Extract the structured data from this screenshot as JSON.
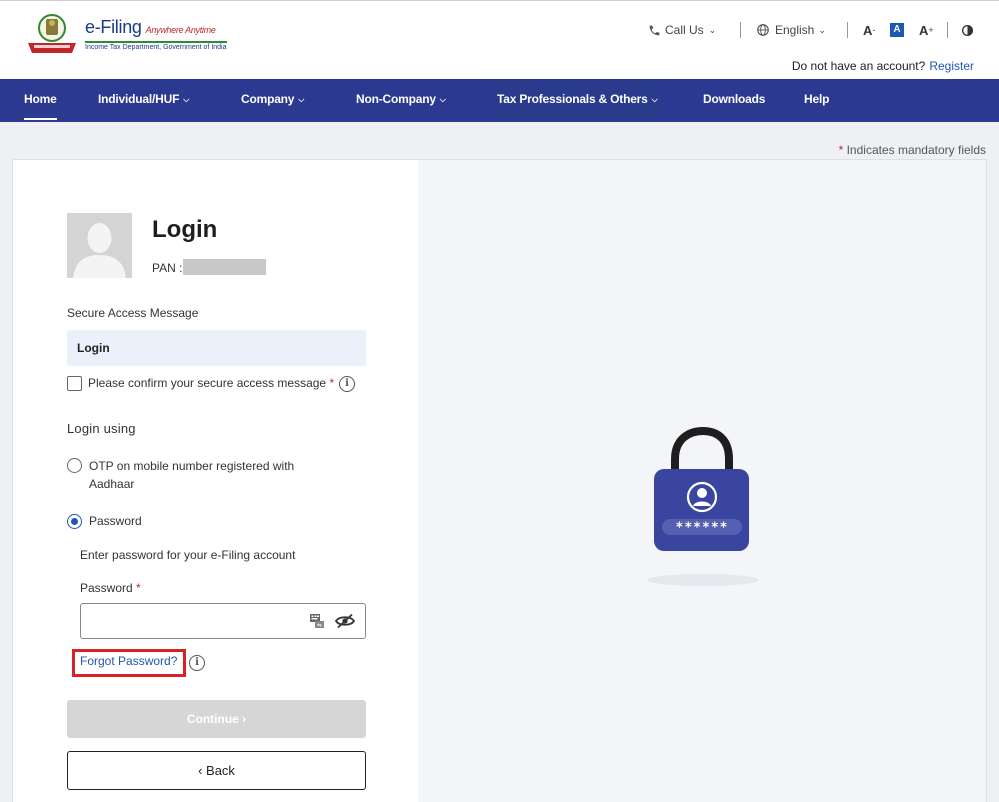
{
  "header": {
    "logo_title": "e-Filing",
    "logo_tagline": "Anywhere Anytime",
    "logo_subtitle": "Income Tax Department, Government of India",
    "call_us": "Call Us",
    "language": "English",
    "font_decrease": "A",
    "font_normal": "A",
    "font_increase": "A",
    "account_prompt": "Do not have an account?",
    "register": "Register"
  },
  "nav": {
    "items": [
      {
        "label": "Home"
      },
      {
        "label": "Individual/HUF"
      },
      {
        "label": "Company"
      },
      {
        "label": "Non-Company"
      },
      {
        "label": "Tax Professionals & Others"
      },
      {
        "label": "Downloads"
      },
      {
        "label": "Help"
      }
    ]
  },
  "mandatory_note": {
    "star": "*",
    "text": "Indicates mandatory fields"
  },
  "login": {
    "title": "Login",
    "pan_label": "PAN :",
    "secure_access_label": "Secure Access Message",
    "secure_access_message": "Login",
    "confirm_label": "Please confirm your secure access message",
    "login_using_label": "Login using",
    "option_otp": "OTP on mobile number registered with Aadhaar",
    "option_password": "Password",
    "password_hint": "Enter password for your e-Filing account",
    "password_label": "Password",
    "password_value": "",
    "forgot_password": "Forgot Password?",
    "continue_label": "Continue",
    "back_label": "Back",
    "lock_mask": "******"
  },
  "colors": {
    "nav_bg": "#2b3990",
    "link": "#1f57b4",
    "required": "#c0272d",
    "highlight_box": "#d7222a",
    "lock_body": "#3a45a0"
  }
}
